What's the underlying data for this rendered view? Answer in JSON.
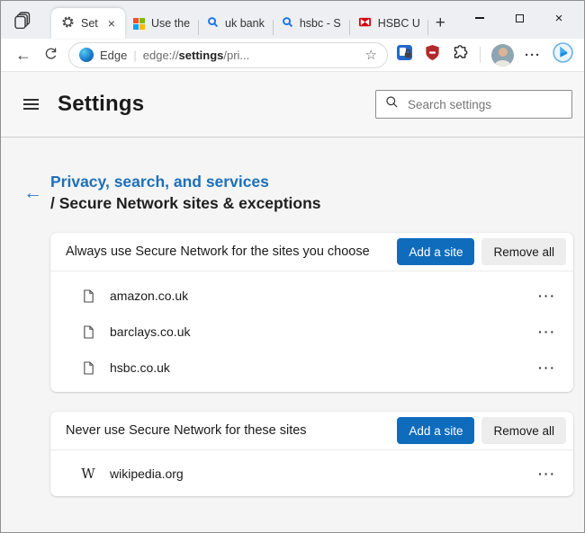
{
  "glyphs": {
    "close": "×",
    "plus": "+",
    "star": "☆",
    "back": "←",
    "more": "···",
    "wikipedia_w": "W"
  },
  "tab_bar": {
    "tabs": [
      {
        "label": "Set"
      },
      {
        "label": "Use the"
      },
      {
        "label": "uk bank"
      },
      {
        "label": "hsbc - S"
      },
      {
        "label": "HSBC U"
      }
    ]
  },
  "toolbar": {
    "brand": "Edge",
    "url_scheme": "edge://",
    "url_host": "settings",
    "url_rest": "/pri..."
  },
  "settings_header": {
    "title": "Settings",
    "search_placeholder": "Search settings"
  },
  "breadcrumb": {
    "parent": "Privacy, search, and services",
    "current": "/ Secure Network sites & exceptions"
  },
  "sections": [
    {
      "title": "Always use Secure Network for the sites you choose",
      "add_button": "Add a site",
      "remove_button": "Remove all",
      "sites": [
        "amazon.co.uk",
        "barclays.co.uk",
        "hsbc.co.uk"
      ]
    },
    {
      "title": "Never use Secure Network for these sites",
      "add_button": "Add a site",
      "remove_button": "Remove all",
      "sites": [
        "wikipedia.org"
      ]
    }
  ],
  "colors": {
    "accent": "#0f6cbd",
    "breadcrumb_link": "#1d70b8",
    "tabbar_bg": "#edeff2",
    "hsbc_red": "#db0011",
    "shield_red": "#b3282d",
    "search_blue": "#1a73e8"
  }
}
